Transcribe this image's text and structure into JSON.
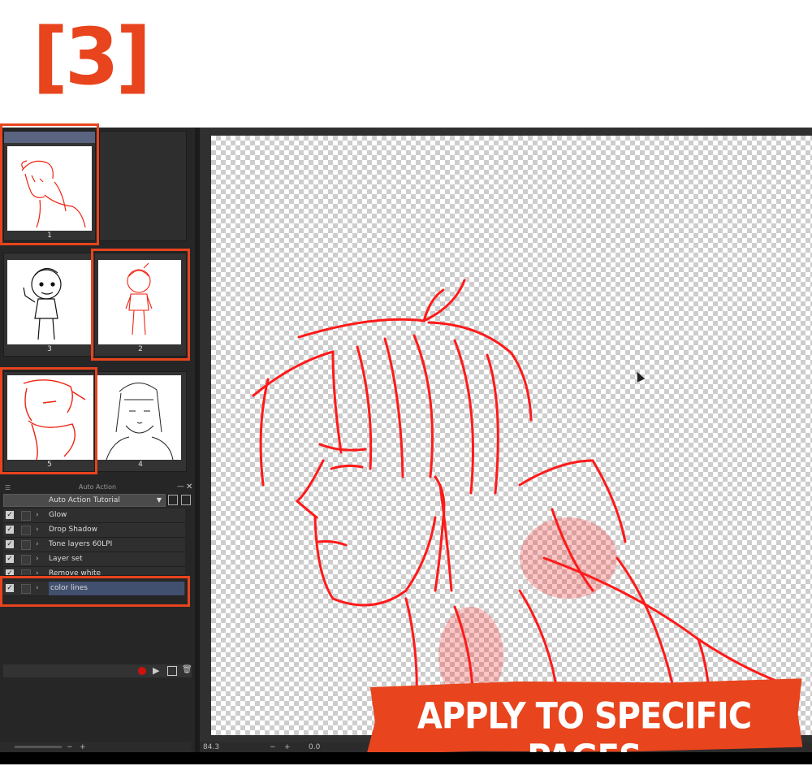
{
  "step": "[3]",
  "pages": [
    {
      "number": "1",
      "highlighted": true
    },
    {
      "number": "3",
      "highlighted": false
    },
    {
      "number": "2",
      "highlighted": true
    },
    {
      "number": "5",
      "highlighted": true
    },
    {
      "number": "4",
      "highlighted": false
    }
  ],
  "auto_action": {
    "title": "Auto Action",
    "set": "Auto Action Tutorial",
    "actions": [
      {
        "label": "Glow"
      },
      {
        "label": "Drop Shadow"
      },
      {
        "label": "Tone layers 60LPI"
      },
      {
        "label": "Layer set"
      },
      {
        "label": "Remove white"
      },
      {
        "label": "color lines"
      }
    ]
  },
  "status": {
    "left_zoom": "",
    "canvas_zoom": "84.3",
    "angle": "0.0"
  },
  "banner": "APPLY TO SPECIFIC PAGES",
  "colors": {
    "accent": "#e8441d",
    "sketch": "#ff1a1a"
  }
}
